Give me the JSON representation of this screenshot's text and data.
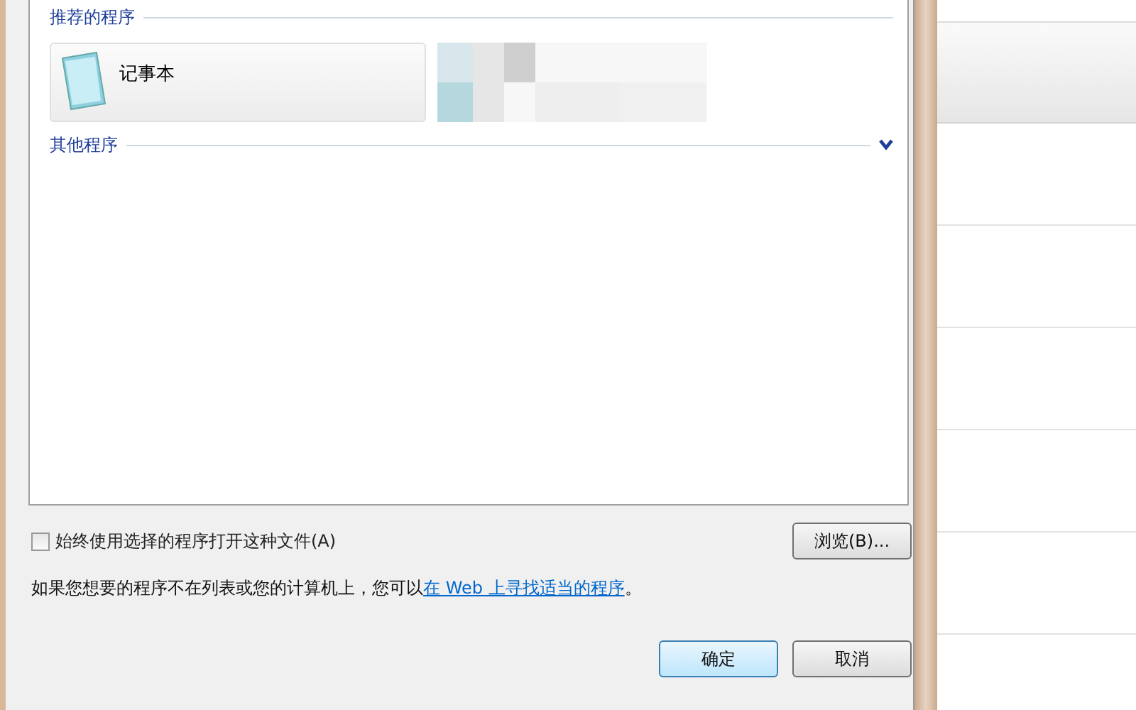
{
  "recommended": {
    "title": "推荐的程序",
    "programs": [
      {
        "name": "记事本",
        "kind": "notepad"
      },
      {
        "kind": "blurred"
      }
    ]
  },
  "other": {
    "title": "其他程序",
    "expanded": false
  },
  "always_use": {
    "label": "始终使用选择的程序打开这种文件(A)",
    "checked": false
  },
  "browse_button": "浏览(B)...",
  "hint": {
    "text": "如果您想要的程序不在列表或您的计算机上，您可以",
    "link": "在 Web 上寻找适当的程序",
    "end": "。"
  },
  "buttons": [
    {
      "label": "确定",
      "default": true
    },
    {
      "label": "取消",
      "default": false
    }
  ]
}
